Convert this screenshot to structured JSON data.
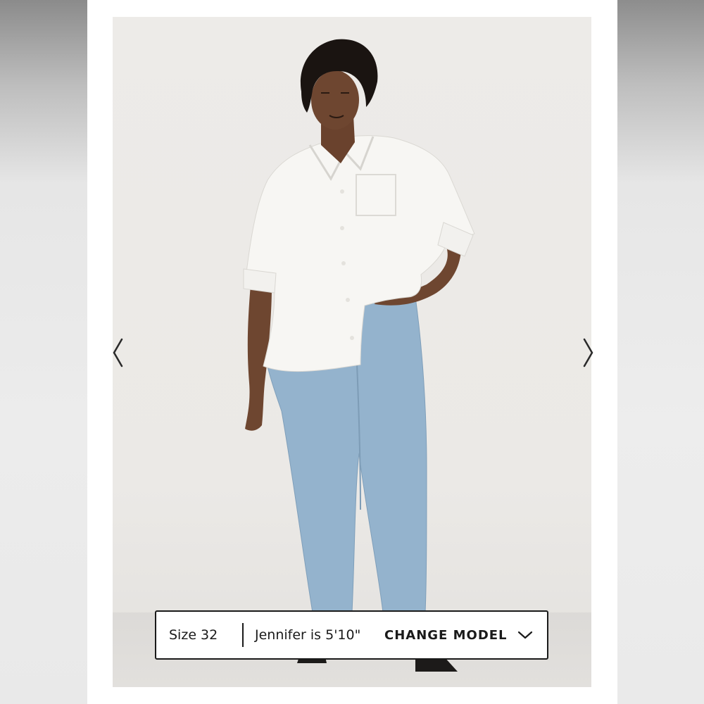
{
  "carousel": {
    "prev_icon": "chevron-left-icon",
    "next_icon": "chevron-right-icon"
  },
  "model_bar": {
    "size_text": "Size 32",
    "height_text": "Jennifer is 5'10\"",
    "change_model_label": "CHANGE MODEL",
    "dropdown_icon": "chevron-down-icon"
  },
  "colors": {
    "backdrop": "#ebe9e6",
    "shirt": "#f7f6f3",
    "denim": "#8fb0cc",
    "skin": "#6e4630",
    "hair": "#1a1411",
    "bar_border": "#1a1a1a"
  }
}
